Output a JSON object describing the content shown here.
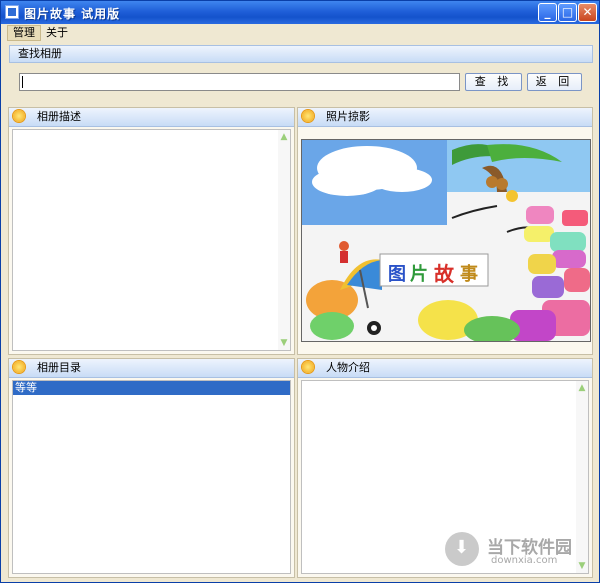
{
  "window": {
    "title": "图片故事 试用版",
    "minimize": "_",
    "maximize": "□",
    "close": "✕"
  },
  "menu": [
    "管理",
    "关于"
  ],
  "search": {
    "title": "查找相册",
    "value": "",
    "find_label": "查 找",
    "back_label": "返 回"
  },
  "panels": {
    "description": {
      "title": "相册描述"
    },
    "photo": {
      "title": "照片掠影"
    },
    "catalog": {
      "title": "相册目录",
      "items": [
        "等等"
      ]
    },
    "people": {
      "title": "人物介绍"
    }
  },
  "photo_logo": [
    "图",
    "片",
    "故",
    "事"
  ],
  "watermark": {
    "name": "当下软件园",
    "url": "downxia.com"
  },
  "colors": {
    "titlebar": "#1f5fd8",
    "selection": "#2f6bc6",
    "panel_header": "#c8dcf6"
  }
}
